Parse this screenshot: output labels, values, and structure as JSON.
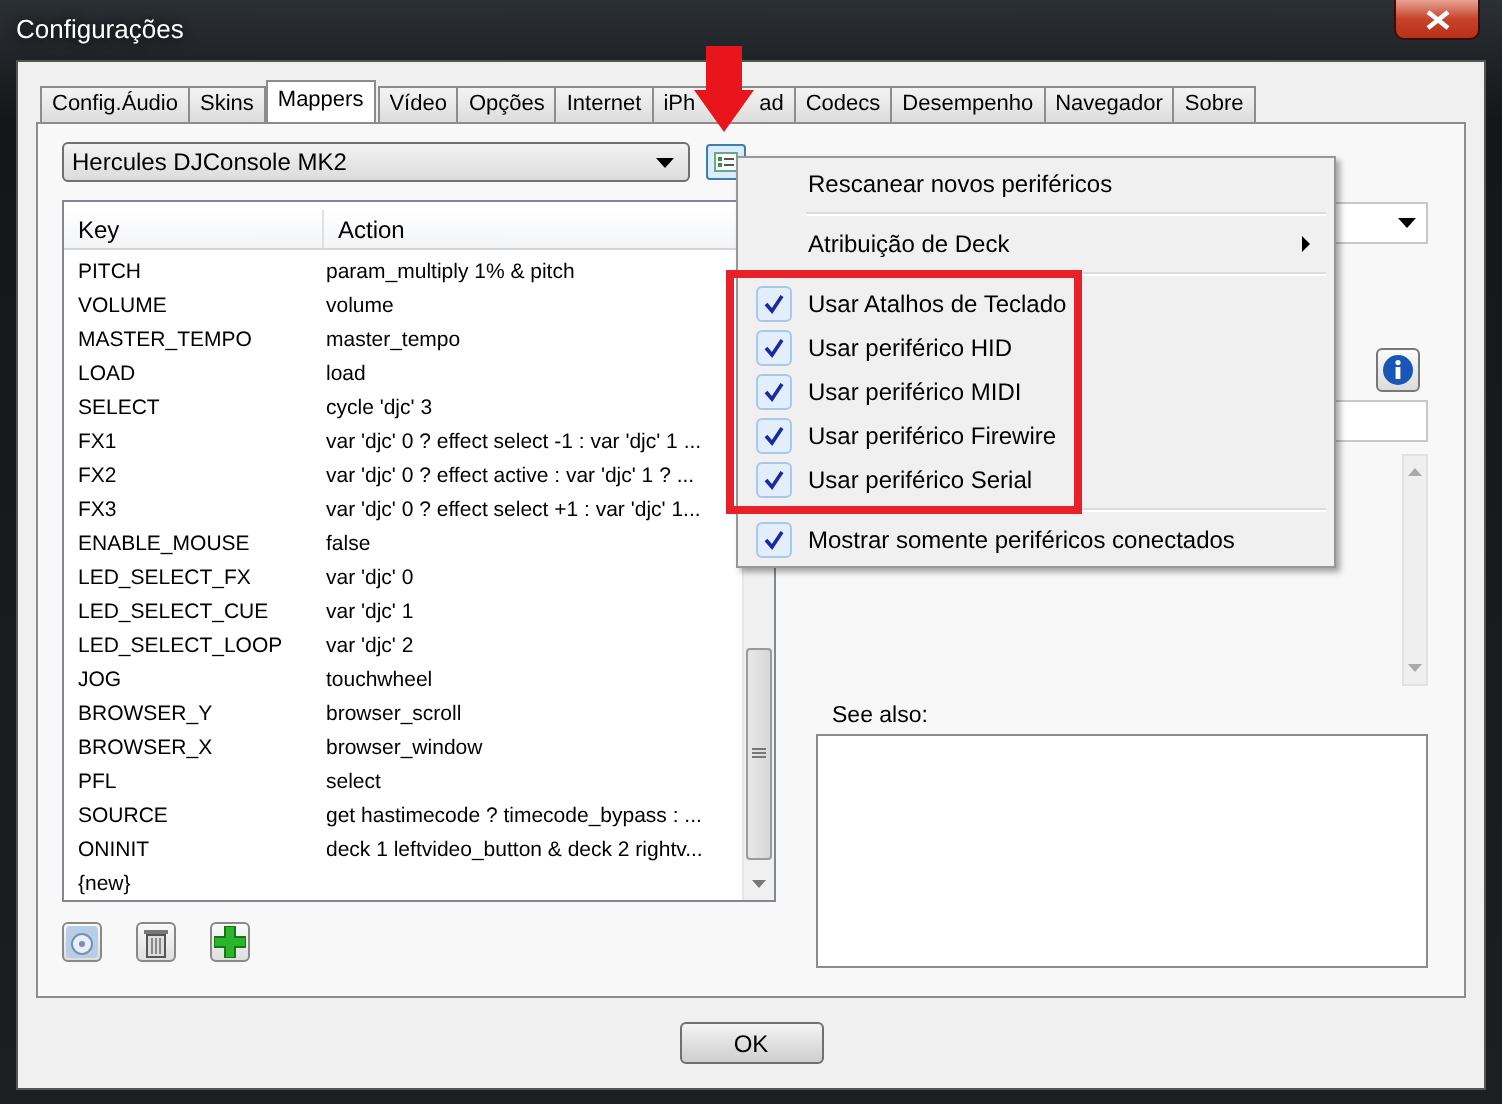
{
  "window": {
    "title": "Configurações"
  },
  "tabs": [
    {
      "label": "Config.Áudio",
      "selected": false
    },
    {
      "label": "Skins",
      "selected": false
    },
    {
      "label": "Mappers",
      "selected": true
    },
    {
      "label": "Vídeo",
      "selected": false
    },
    {
      "label": "Opções",
      "selected": false
    },
    {
      "label": "Internet",
      "selected": false
    },
    {
      "label": "iPh",
      "label_end": "ad",
      "selected": false
    },
    {
      "label": "Codecs",
      "selected": false
    },
    {
      "label": "Desempenho",
      "selected": false
    },
    {
      "label": "Navegador",
      "selected": false
    },
    {
      "label": "Sobre",
      "selected": false
    }
  ],
  "mapper_select": {
    "value": "Hercules DJConsole MK2"
  },
  "table": {
    "columns": [
      "Key",
      "Action"
    ],
    "rows": [
      {
        "key": "PITCH",
        "action": "param_multiply 1% & pitch"
      },
      {
        "key": "VOLUME",
        "action": "volume"
      },
      {
        "key": "MASTER_TEMPO",
        "action": "master_tempo"
      },
      {
        "key": "LOAD",
        "action": "load"
      },
      {
        "key": "SELECT",
        "action": "cycle 'djc' 3"
      },
      {
        "key": "FX1",
        "action": "var 'djc' 0 ? effect select -1 : var 'djc' 1 ..."
      },
      {
        "key": "FX2",
        "action": "var 'djc' 0 ? effect active : var 'djc' 1 ? ..."
      },
      {
        "key": "FX3",
        "action": "var 'djc' 0 ? effect select +1 : var 'djc' 1..."
      },
      {
        "key": "ENABLE_MOUSE",
        "action": "false"
      },
      {
        "key": "LED_SELECT_FX",
        "action": "var 'djc' 0"
      },
      {
        "key": "LED_SELECT_CUE",
        "action": "var 'djc' 1"
      },
      {
        "key": "LED_SELECT_LOOP",
        "action": "var 'djc' 2"
      },
      {
        "key": "JOG",
        "action": "touchwheel"
      },
      {
        "key": "BROWSER_Y",
        "action": "browser_scroll"
      },
      {
        "key": "BROWSER_X",
        "action": "browser_window"
      },
      {
        "key": "PFL",
        "action": "select"
      },
      {
        "key": "SOURCE",
        "action": "get hastimecode ? timecode_bypass : ..."
      },
      {
        "key": "ONINIT",
        "action": "deck 1 leftvideo_button & deck 2 rightv..."
      },
      {
        "key": "{new}"
      }
    ]
  },
  "menu": {
    "sections": [
      {
        "highlighted": false,
        "items": [
          {
            "kind": "command",
            "label": "Rescanear novos periféricos"
          }
        ]
      },
      {
        "highlighted": false,
        "items": [
          {
            "kind": "submenu",
            "label": "Atribuição de Deck"
          }
        ]
      },
      {
        "highlighted": true,
        "items": [
          {
            "kind": "check",
            "label": "Usar Atalhos de Teclado",
            "checked": true
          },
          {
            "kind": "check",
            "label": "Usar periférico HID",
            "checked": true
          },
          {
            "kind": "check",
            "label": "Usar periférico MIDI",
            "checked": true
          },
          {
            "kind": "check",
            "label": "Usar periférico Firewire",
            "checked": true
          },
          {
            "kind": "check",
            "label": "Usar periférico Serial",
            "checked": true
          }
        ]
      },
      {
        "highlighted": false,
        "items": [
          {
            "kind": "check",
            "label": "Mostrar somente periféricos conectados",
            "checked": true
          }
        ]
      }
    ]
  },
  "see_also": {
    "label": "See also:"
  },
  "ok_button": {
    "label": "OK"
  }
}
